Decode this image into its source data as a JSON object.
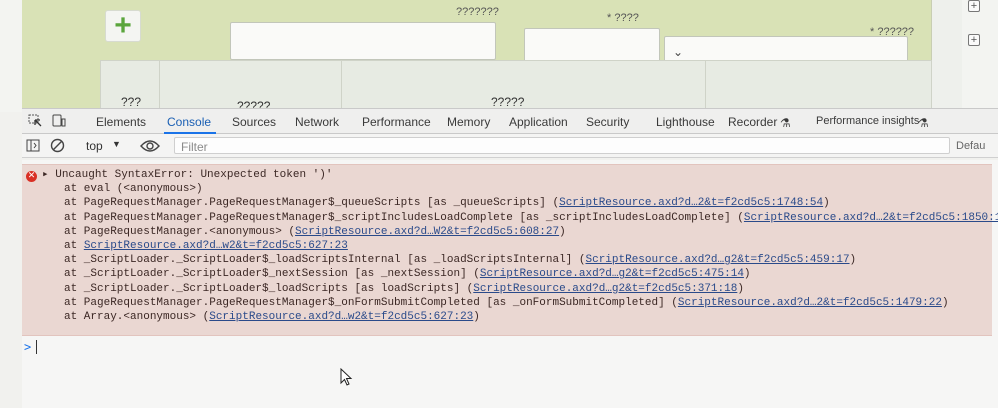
{
  "page": {
    "add_symbol": "+",
    "labels": {
      "col_a": "???????",
      "col_b": "* ????",
      "col_c": "* ??????"
    },
    "chevron": "⌄",
    "table_headers": [
      "???",
      "?????",
      "?????",
      "(????) ??????"
    ]
  },
  "devtools": {
    "tabs": [
      "Elements",
      "Console",
      "Sources",
      "Network",
      "Performance",
      "Memory",
      "Application",
      "Security",
      "Lighthouse",
      "Recorder",
      "Performance insights"
    ],
    "active_tab": "Console",
    "context": "top",
    "filter_placeholder": "Filter",
    "level_label": "Defau"
  },
  "console": {
    "lines": [
      {
        "text": "▸ Uncaught SyntaxError: Unexpected token ')'",
        "link": ""
      },
      {
        "text": "at eval (<anonymous>)",
        "link": ""
      },
      {
        "text": "at PageRequestManager.PageRequestManager$_queueScripts [as _queueScripts] (",
        "link": "ScriptResource.axd?d…2&t=f2cd5c5:1748:54",
        "tail": ")"
      },
      {
        "text": "at PageRequestManager.PageRequestManager$_scriptIncludesLoadComplete [as _scriptIncludesLoadComplete] (",
        "link": "ScriptResource.axd?d…2&t=f2cd5c5:1850:14",
        "tail": ")"
      },
      {
        "text": "at PageRequestManager.<anonymous> (",
        "link": "ScriptResource.axd?d…W2&t=f2cd5c5:608:27",
        "tail": ")"
      },
      {
        "text": "at ",
        "link": "ScriptResource.axd?d…w2&t=f2cd5c5:627:23",
        "tail": ""
      },
      {
        "text": "at _ScriptLoader._ScriptLoader$_loadScriptsInternal [as _loadScriptsInternal] (",
        "link": "ScriptResource.axd?d…g2&t=f2cd5c5:459:17",
        "tail": ")"
      },
      {
        "text": "at _ScriptLoader._ScriptLoader$_nextSession [as _nextSession] (",
        "link": "ScriptResource.axd?d…g2&t=f2cd5c5:475:14",
        "tail": ")"
      },
      {
        "text": "at _ScriptLoader._ScriptLoader$_loadScripts [as loadScripts] (",
        "link": "ScriptResource.axd?d…g2&t=f2cd5c5:371:18",
        "tail": ")"
      },
      {
        "text": "at PageRequestManager.PageRequestManager$_onFormSubmitCompleted [as _onFormSubmitCompleted] (",
        "link": "ScriptResource.axd?d…2&t=f2cd5c5:1479:22",
        "tail": ")"
      },
      {
        "text": "at Array.<anonymous> (",
        "link": "ScriptResource.axd?d…w2&t=f2cd5c5:627:23",
        "tail": ")"
      }
    ],
    "prompt_symbol": ">",
    "error_symbol": "✕"
  },
  "colors": {
    "panel_green": "#d9e2b6",
    "error_bg": "#ead7d2",
    "active_tab": "#1a73e8",
    "error_icon": "#d93025"
  }
}
